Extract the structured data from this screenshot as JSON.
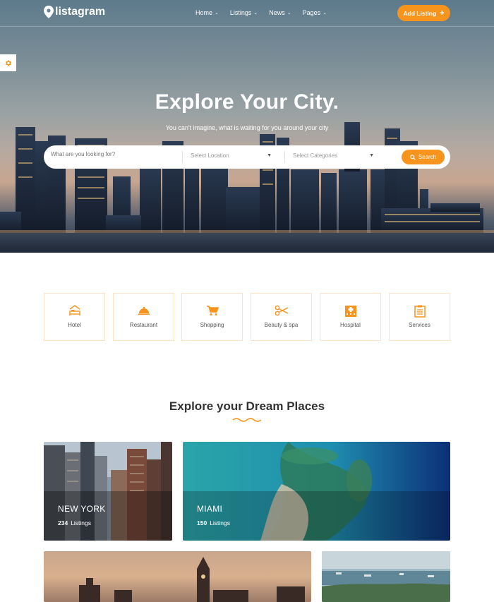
{
  "header": {
    "logo_text": "listagram",
    "nav": [
      {
        "label": "Home"
      },
      {
        "label": "Listings"
      },
      {
        "label": "News"
      },
      {
        "label": "Pages"
      }
    ],
    "add_listing_label": "Add Listing"
  },
  "hero": {
    "title": "Explore Your City.",
    "subtitle": "You can't imagine, what is waiting for you around your city",
    "search": {
      "placeholder": "What are you looking for?",
      "location_placeholder": "Select Location",
      "category_placeholder": "Select Categories",
      "button_label": "Search"
    }
  },
  "categories": [
    {
      "label": "Hotel",
      "icon": "bed-icon"
    },
    {
      "label": "Restaurant",
      "icon": "cloche-icon"
    },
    {
      "label": "Shopping",
      "icon": "cart-icon"
    },
    {
      "label": "Beauty & spa",
      "icon": "scissors-icon"
    },
    {
      "label": "Hospital",
      "icon": "hospital-icon"
    },
    {
      "label": "Services",
      "icon": "clipboard-icon"
    }
  ],
  "places_section": {
    "title": "Explore your Dream Places",
    "places": [
      {
        "city": "NEW YORK",
        "count": "234",
        "count_label": "Listings"
      },
      {
        "city": "MIAMI",
        "count": "150",
        "count_label": "Listings"
      }
    ]
  },
  "colors": {
    "accent": "#f7941d",
    "category_border": "#fbe3c4"
  }
}
